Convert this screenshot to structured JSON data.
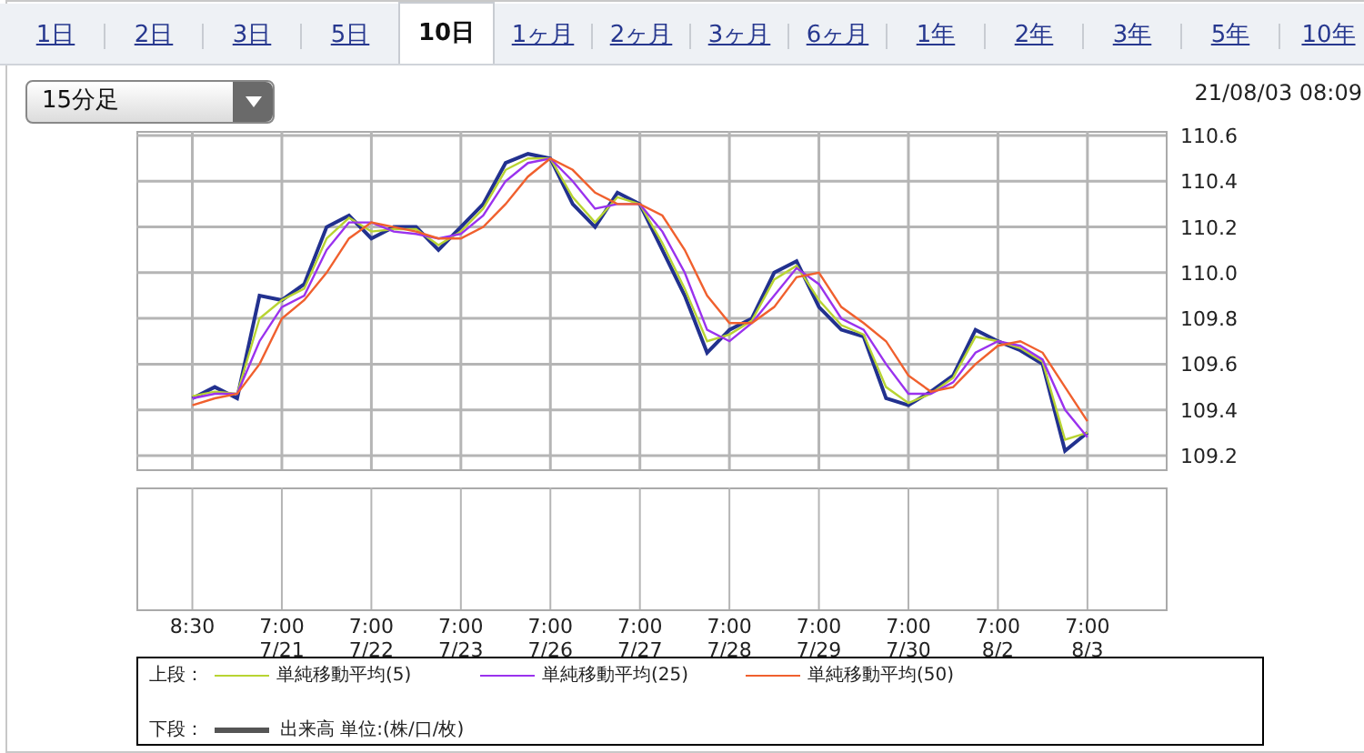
{
  "tabs": [
    {
      "label": "1日",
      "selected": false
    },
    {
      "label": "2日",
      "selected": false
    },
    {
      "label": "3日",
      "selected": false
    },
    {
      "label": "5日",
      "selected": false
    },
    {
      "label": "10日",
      "selected": true
    },
    {
      "label": "1ヶ月",
      "selected": false
    },
    {
      "label": "2ヶ月",
      "selected": false
    },
    {
      "label": "3ヶ月",
      "selected": false
    },
    {
      "label": "6ヶ月",
      "selected": false
    },
    {
      "label": "1年",
      "selected": false
    },
    {
      "label": "2年",
      "selected": false
    },
    {
      "label": "3年",
      "selected": false
    },
    {
      "label": "5年",
      "selected": false
    },
    {
      "label": "10年",
      "selected": false
    }
  ],
  "interval_select": {
    "value": "15分足"
  },
  "timestamp": "21/08/03 08:09",
  "chart": {
    "chart_data": {
      "type": "line",
      "series": [
        {
          "color": "#22318f",
          "values": [
            null,
            null,
            109.45,
            109.5,
            109.45,
            109.9,
            109.88,
            109.95,
            110.2,
            110.25,
            110.15,
            110.2,
            110.2,
            110.1,
            110.2,
            110.3,
            110.48,
            110.52,
            110.5,
            110.3,
            110.2,
            110.35,
            110.3,
            110.1,
            109.9,
            109.65,
            109.75,
            109.8,
            110.0,
            110.05,
            109.85,
            109.75,
            109.72,
            109.45,
            109.42,
            109.48,
            109.55,
            109.75,
            109.7,
            109.66,
            109.6,
            109.22,
            109.3,
            null,
            null,
            null
          ]
        },
        {
          "name": "単純移動平均(5)",
          "color": "#b8d432",
          "values": [
            null,
            null,
            109.46,
            109.48,
            109.47,
            109.8,
            109.88,
            109.93,
            110.15,
            110.24,
            110.18,
            110.19,
            110.19,
            110.12,
            110.18,
            110.28,
            110.45,
            110.5,
            110.5,
            110.33,
            110.22,
            110.33,
            110.3,
            110.13,
            109.93,
            109.7,
            109.73,
            109.79,
            109.97,
            110.03,
            109.88,
            109.77,
            109.73,
            109.5,
            109.43,
            109.47,
            109.54,
            109.72,
            109.7,
            109.67,
            109.61,
            109.27,
            109.3,
            null,
            null,
            null
          ]
        },
        {
          "name": "単純移動平均(25)",
          "color": "#9a32ee",
          "values": [
            null,
            null,
            109.45,
            109.47,
            109.47,
            109.7,
            109.85,
            109.9,
            110.1,
            110.22,
            110.22,
            110.18,
            110.17,
            110.15,
            110.17,
            110.25,
            110.4,
            110.48,
            110.5,
            110.4,
            110.28,
            110.3,
            110.3,
            110.18,
            110.0,
            109.75,
            109.7,
            109.78,
            109.9,
            110.02,
            109.95,
            109.8,
            109.75,
            109.6,
            109.47,
            109.47,
            109.52,
            109.65,
            109.7,
            109.68,
            109.62,
            109.4,
            109.28,
            null,
            null,
            null
          ]
        },
        {
          "name": "単純移動平均(50)",
          "color": "#f0602e",
          "values": [
            null,
            null,
            109.42,
            109.45,
            109.47,
            109.6,
            109.8,
            109.88,
            110.0,
            110.15,
            110.22,
            110.2,
            110.18,
            110.15,
            110.15,
            110.2,
            110.3,
            110.42,
            110.5,
            110.45,
            110.35,
            110.3,
            110.3,
            110.25,
            110.1,
            109.9,
            109.78,
            109.78,
            109.85,
            109.98,
            110.0,
            109.85,
            109.78,
            109.7,
            109.55,
            109.48,
            109.5,
            109.6,
            109.68,
            109.7,
            109.65,
            109.5,
            109.35,
            null,
            null,
            null
          ]
        }
      ],
      "ylim": [
        109.14,
        110.62
      ],
      "grid": true,
      "yticks": [
        {
          "value": 109.2,
          "label": "109.2"
        },
        {
          "value": 109.4,
          "label": "109.4"
        },
        {
          "value": 109.6,
          "label": "109.6"
        },
        {
          "value": 109.8,
          "label": "109.8"
        },
        {
          "value": 110.0,
          "label": "110.0"
        },
        {
          "value": 110.2,
          "label": "110.2"
        },
        {
          "value": 110.4,
          "label": "110.4"
        },
        {
          "value": 110.6,
          "label": "110.6"
        }
      ]
    }
  },
  "time_axis_labels": [
    "8:30",
    "7:00 7/21",
    "7:00 7/22",
    "7:00 7/23",
    "7:00 7/26",
    "7:00 7/27",
    "7:00 7/28",
    "7:00 7/29",
    "7:00 7/30",
    "7:00 8/2",
    "7:00 8/3"
  ],
  "legend": {
    "upper_label": "上段：",
    "lower_label": "下段：",
    "lower_item": {
      "label": "出来高 単位:(株/口/枚)",
      "color": "#555555"
    }
  }
}
